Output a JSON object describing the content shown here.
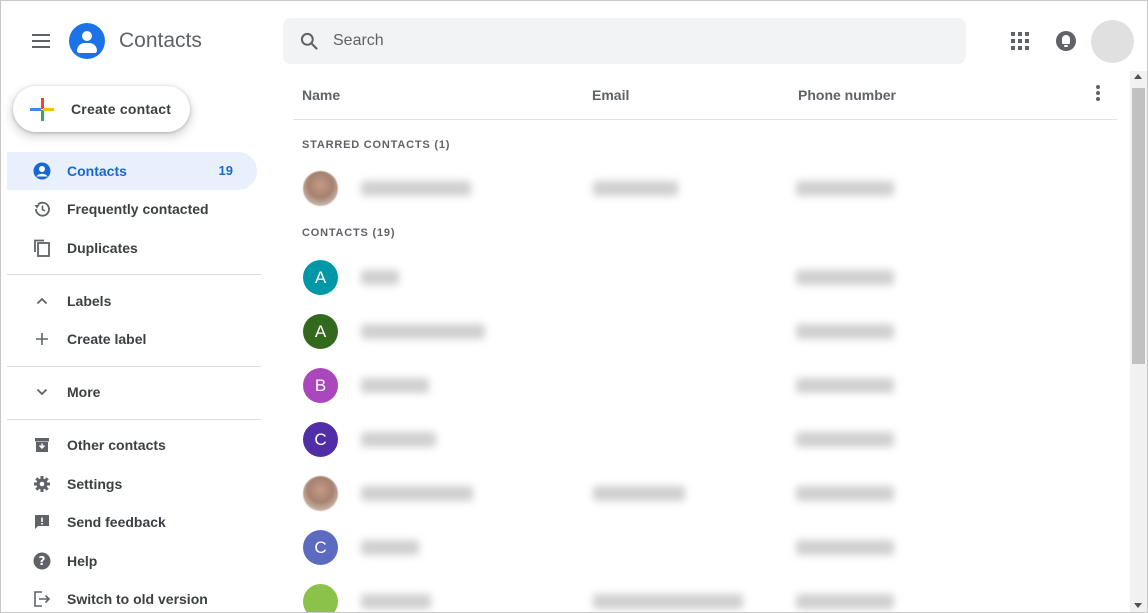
{
  "header": {
    "app_title": "Contacts",
    "search_placeholder": "Search",
    "search_value": ""
  },
  "sidebar": {
    "create_label": "Create contact",
    "items": [
      {
        "label": "Contacts",
        "count": "19",
        "icon": "person-icon",
        "active": true
      },
      {
        "label": "Frequently contacted",
        "icon": "history-icon"
      },
      {
        "label": "Duplicates",
        "icon": "duplicates-icon"
      },
      {
        "label": "Labels",
        "icon": "chevron-up-icon"
      },
      {
        "label": "Create label",
        "icon": "plus-icon"
      },
      {
        "label": "More",
        "icon": "chevron-down-icon"
      },
      {
        "label": "Other contacts",
        "icon": "archive-icon"
      },
      {
        "label": "Settings",
        "icon": "gear-icon"
      },
      {
        "label": "Send feedback",
        "icon": "feedback-icon"
      },
      {
        "label": "Help",
        "icon": "help-icon"
      },
      {
        "label": "Switch to old version",
        "icon": "exit-icon"
      }
    ]
  },
  "table": {
    "columns": {
      "name": "Name",
      "email": "Email",
      "phone": "Phone number"
    },
    "starred_label": "STARRED CONTACTS (1)",
    "contacts_label": "CONTACTS (19)",
    "rows": [
      {
        "initial": "",
        "avatar": "photo"
      },
      {
        "initial": "A",
        "color": "#0097a7"
      },
      {
        "initial": "A",
        "color": "#33691e"
      },
      {
        "initial": "B",
        "color": "#ab47bc"
      },
      {
        "initial": "C",
        "color": "#512da8"
      },
      {
        "initial": "",
        "avatar": "photo"
      },
      {
        "initial": "C",
        "color": "#5c6bc0"
      },
      {
        "initial": "",
        "avatar": "android"
      }
    ]
  },
  "colors": {
    "accent": "#1a73e8",
    "active_bg": "#e8f0fe",
    "active_text": "#1967d2"
  }
}
